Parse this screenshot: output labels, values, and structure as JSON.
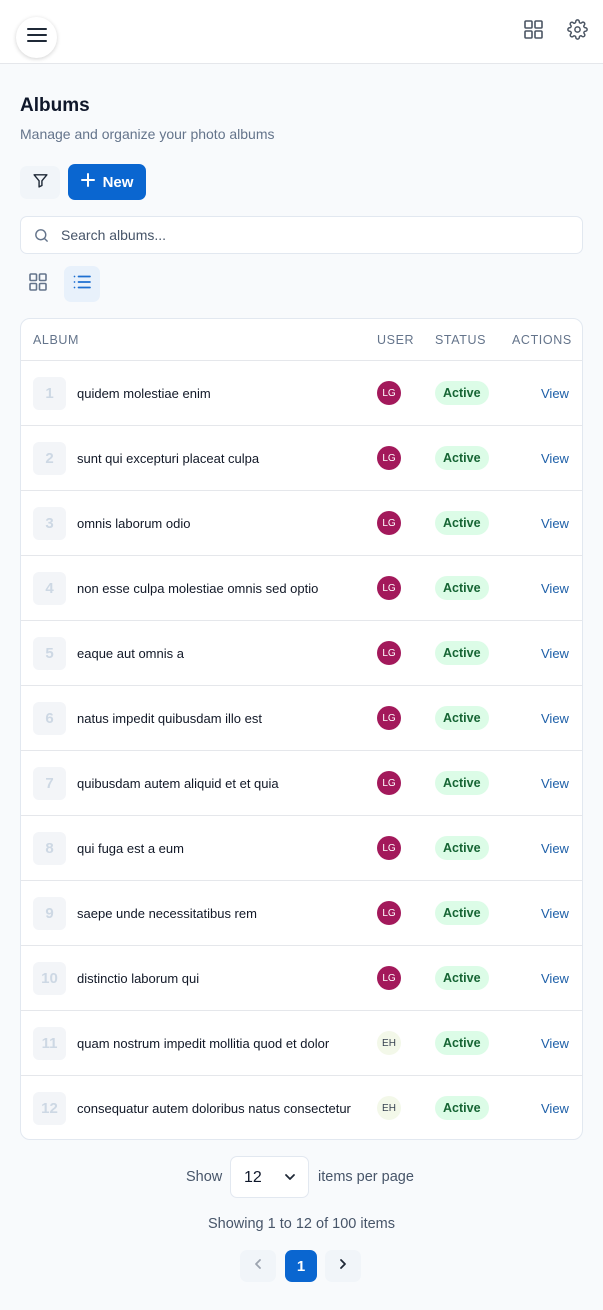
{
  "header": {
    "menu_icon": "hamburger-icon",
    "grid_icon": "grid-icon",
    "settings_icon": "gear-icon"
  },
  "page": {
    "title": "Albums",
    "subtitle": "Manage and organize your photo albums"
  },
  "toolbar": {
    "filter_icon": "filter-icon",
    "new_label": "New"
  },
  "search": {
    "placeholder": "Search albums...",
    "value": ""
  },
  "view_toggle": {
    "options": [
      "grid",
      "list"
    ],
    "selected": "list"
  },
  "table": {
    "columns": [
      "ALBUM",
      "USER",
      "STATUS",
      "ACTIONS"
    ],
    "rows": [
      {
        "num": "1",
        "title": "quidem molestiae enim",
        "user": "LG",
        "status": "Active",
        "action": "View"
      },
      {
        "num": "2",
        "title": "sunt qui excepturi placeat culpa",
        "user": "LG",
        "status": "Active",
        "action": "View"
      },
      {
        "num": "3",
        "title": "omnis laborum odio",
        "user": "LG",
        "status": "Active",
        "action": "View"
      },
      {
        "num": "4",
        "title": "non esse culpa molestiae omnis sed optio",
        "user": "LG",
        "status": "Active",
        "action": "View"
      },
      {
        "num": "5",
        "title": "eaque aut omnis a",
        "user": "LG",
        "status": "Active",
        "action": "View"
      },
      {
        "num": "6",
        "title": "natus impedit quibusdam illo est",
        "user": "LG",
        "status": "Active",
        "action": "View"
      },
      {
        "num": "7",
        "title": "quibusdam autem aliquid et et quia",
        "user": "LG",
        "status": "Active",
        "action": "View"
      },
      {
        "num": "8",
        "title": "qui fuga est a eum",
        "user": "LG",
        "status": "Active",
        "action": "View"
      },
      {
        "num": "9",
        "title": "saepe unde necessitatibus rem",
        "user": "LG",
        "status": "Active",
        "action": "View"
      },
      {
        "num": "10",
        "title": "distinctio laborum qui",
        "user": "LG",
        "status": "Active",
        "action": "View"
      },
      {
        "num": "11",
        "title": "quam nostrum impedit mollitia quod et dolor",
        "user": "EH",
        "status": "Active",
        "action": "View"
      },
      {
        "num": "12",
        "title": "consequatur autem doloribus natus consectetur",
        "user": "EH",
        "status": "Active",
        "action": "View"
      }
    ]
  },
  "user_colors": {
    "LG": {
      "bg": "#a3195b",
      "fg": "#ffffff"
    },
    "EH": {
      "bg": "#f3f8e9",
      "fg": "#374151"
    }
  },
  "pagination": {
    "show_label": "Show",
    "per_page_value": "12",
    "per_page_suffix": "items per page",
    "summary": "Showing 1 to 12 of 100 items",
    "current_page": "1"
  },
  "colors": {
    "primary": "#0a66d0",
    "status_bg": "#dcfce7",
    "status_fg": "#166534",
    "link": "#1d5fa8"
  }
}
